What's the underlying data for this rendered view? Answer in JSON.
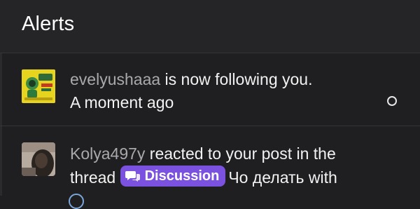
{
  "header": {
    "title": "Alerts"
  },
  "alerts": [
    {
      "username": "evelyushaaa",
      "message": " is now following you.",
      "time": "A moment ago",
      "avatar_icon": "sticker-avatar-icon"
    },
    {
      "username": "Kolya497y",
      "message_before": " reacted to your post in the thread ",
      "prefix_badge": "Discussion",
      "thread_title": "Чо делать with",
      "avatar_icon": "photo-avatar-icon"
    }
  ],
  "colors": {
    "background": "#1f1f21",
    "header": "#252527",
    "username": "#a9a9ad",
    "badge": "#7b52e0"
  }
}
